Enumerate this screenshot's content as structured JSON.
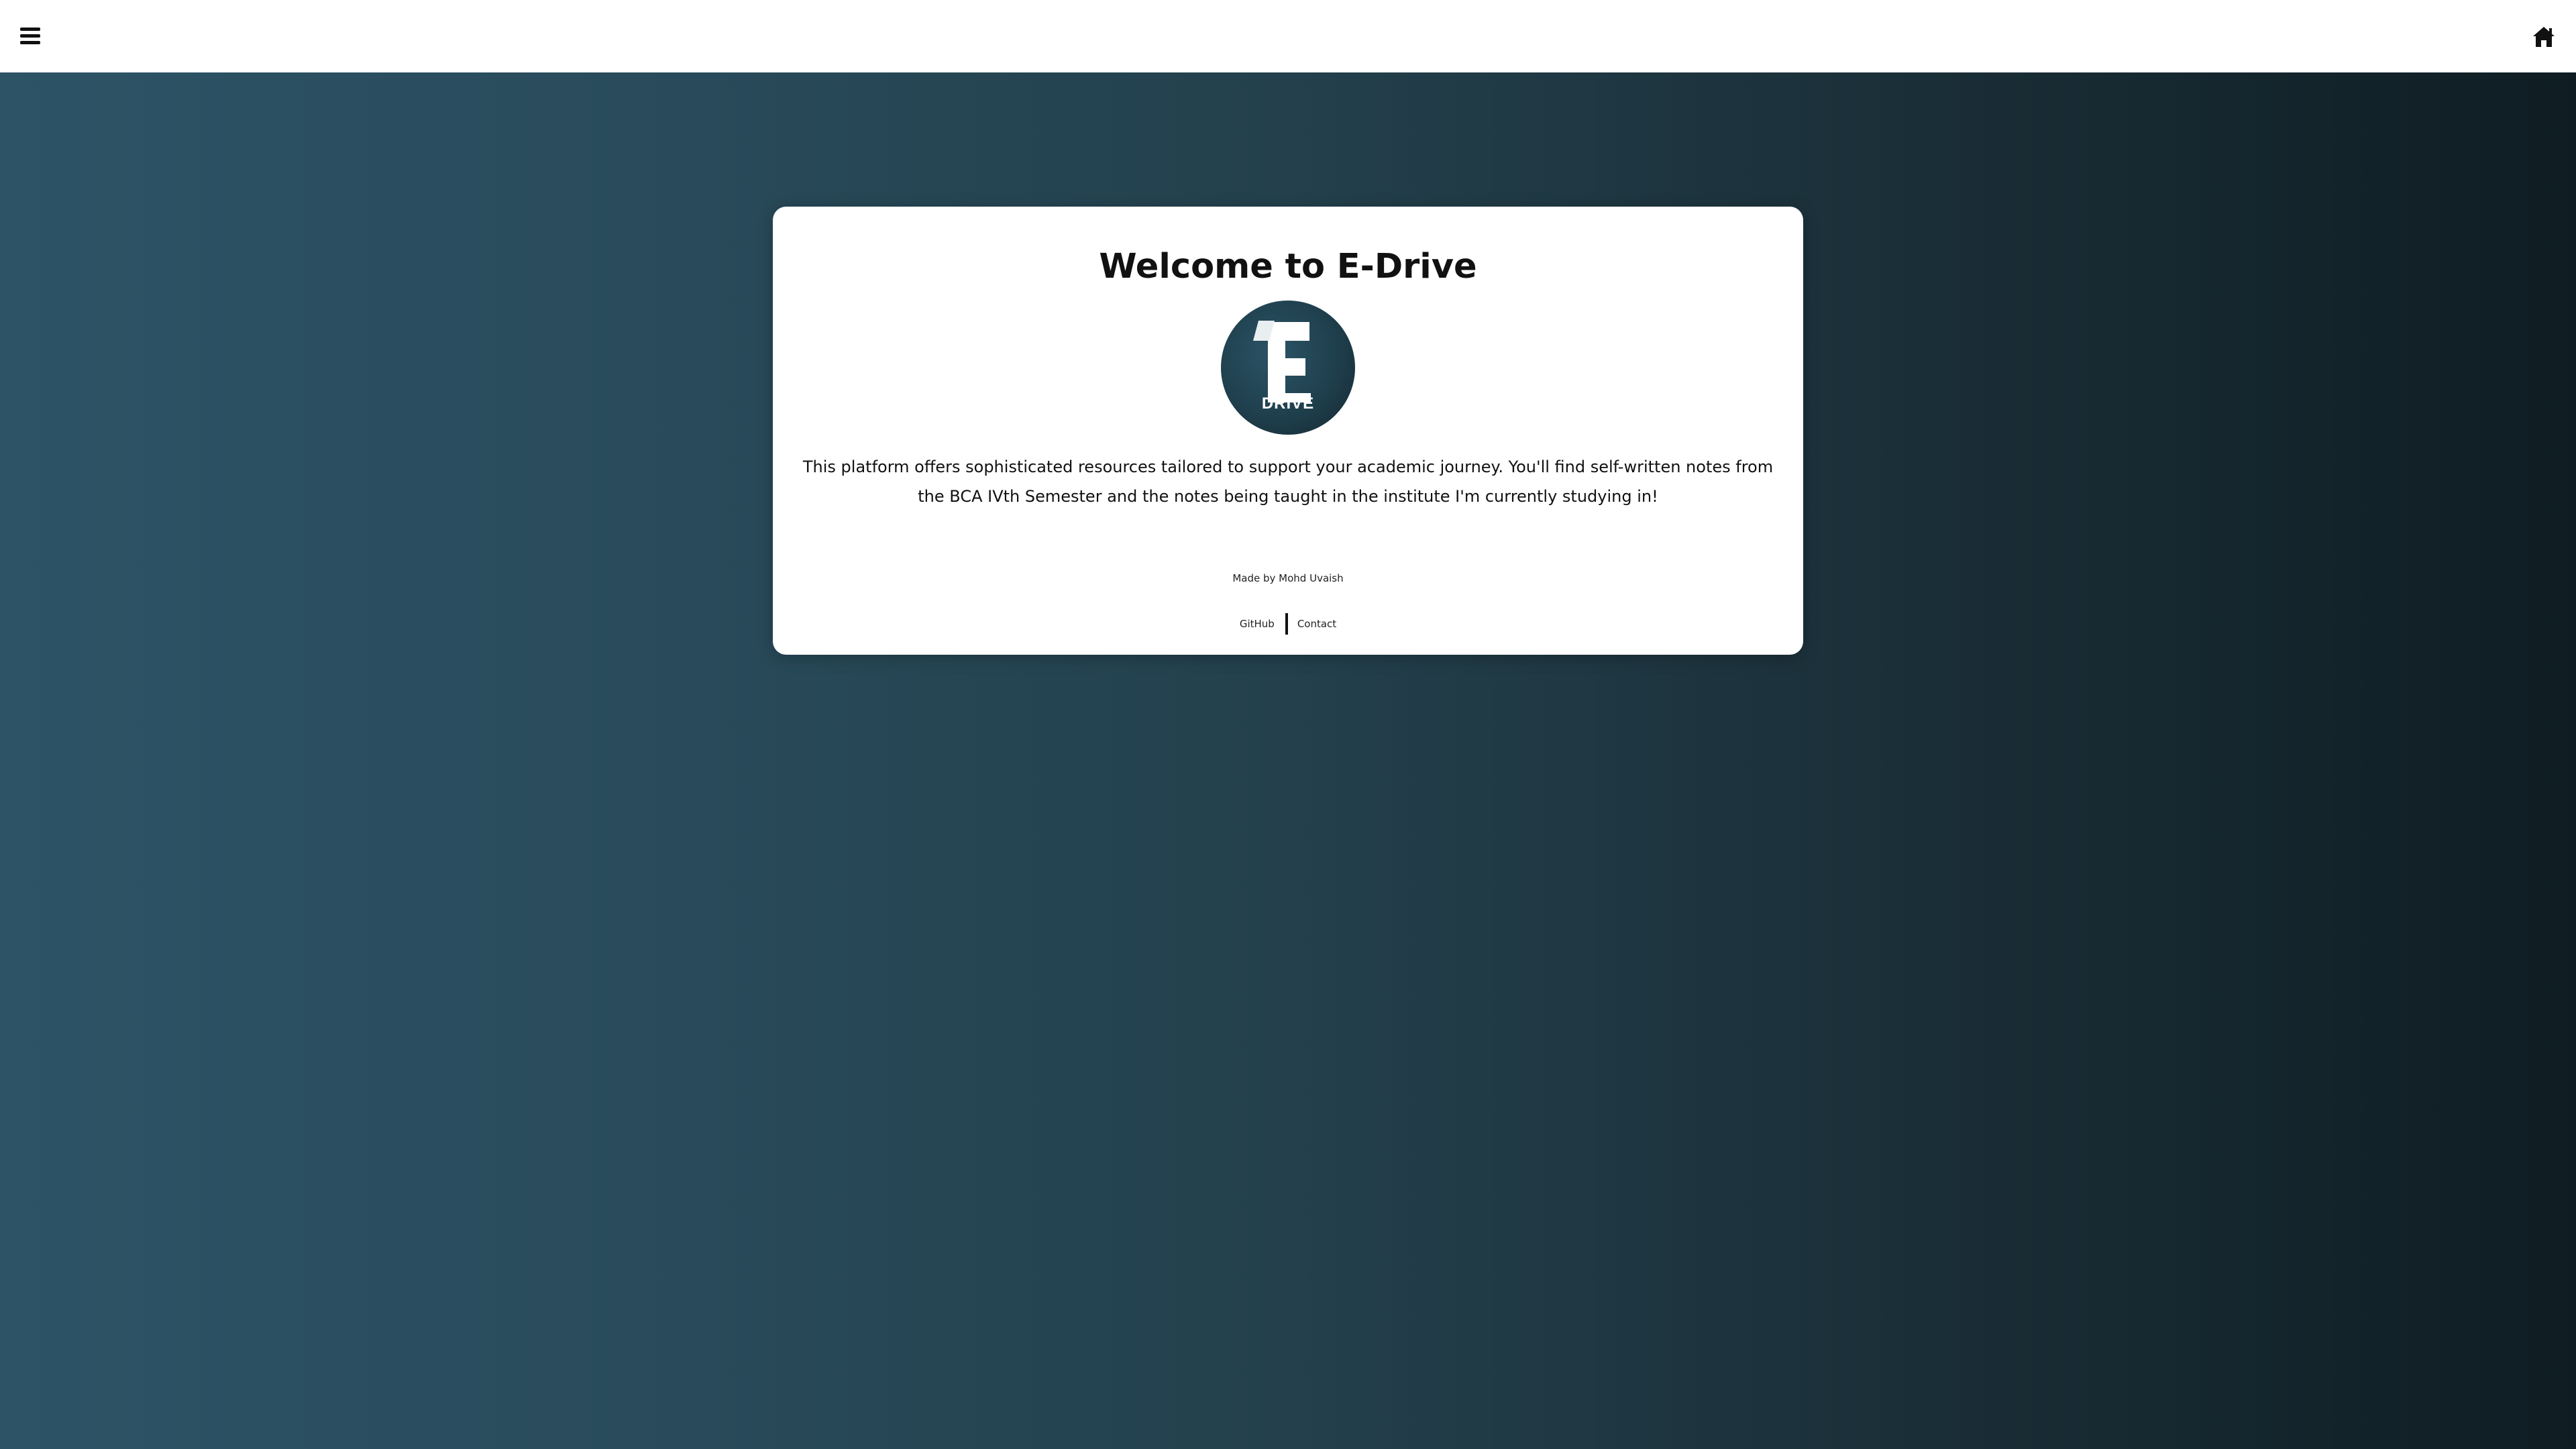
{
  "nav": {
    "menu_icon": "hamburger-menu-icon",
    "home_icon": "home-icon"
  },
  "card": {
    "title": "Welcome to E-Drive",
    "logo": {
      "letter": "E",
      "caption": "DRIVE",
      "background_color": "#1f3f4d"
    },
    "description": "This platform offers sophisticated resources tailored to support your academic journey. You'll find self-written notes from the BCA IVth Semester and the notes being taught in the institute I'm currently studying in!",
    "credit": "Made by Mohd Uvaish",
    "links": {
      "github": "GitHub",
      "contact": "Contact"
    }
  },
  "colors": {
    "gradient_left": "#2c5366",
    "gradient_right": "#0f1d23",
    "card_background": "#ffffff"
  }
}
